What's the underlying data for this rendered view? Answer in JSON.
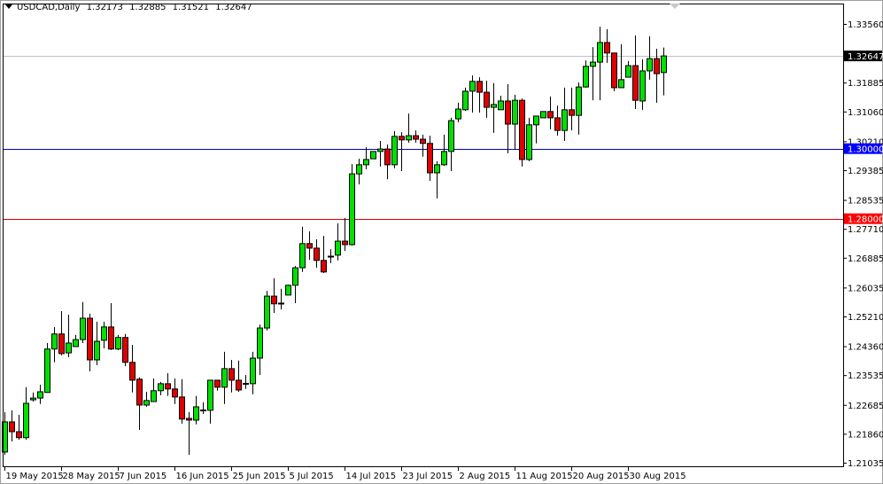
{
  "header": {
    "symbol": "USDCAD,Daily",
    "open": "1.32173",
    "high": "1.32885",
    "low": "1.31521",
    "close": "1.32647"
  },
  "colors": {
    "bull": "#00e000",
    "bear": "#e00000",
    "support_blue": "#0000c0",
    "support_red": "#e00000",
    "current": "#c0c0c0"
  },
  "chart_data": {
    "type": "candlestick",
    "title": "USDCAD,Daily",
    "ylim": [
      1.20933,
      1.34142
    ],
    "y_ticks": [
      "1.33560",
      "1.31885",
      "1.31060",
      "1.30210",
      "1.29385",
      "1.28535",
      "1.27710",
      "1.26885",
      "1.26035",
      "1.25210",
      "1.24360",
      "1.23535",
      "1.22685",
      "1.21860",
      "1.21035"
    ],
    "x_labels": [
      "19 May 2015",
      "28 May 2015",
      "7 Jun 2015",
      "16 Jun 2015",
      "25 Jun 2015",
      "5 Jul 2015",
      "14 Jul 2015",
      "23 Jul 2015",
      "2 Aug 2015",
      "11 Aug 2015",
      "20 Aug 2015",
      "30 Aug 2015"
    ],
    "x_label_every": 8,
    "horizontal_lines": [
      {
        "price": "1.30000",
        "value": 1.3,
        "color": "#0000c0",
        "label_bg": "#0000ff"
      },
      {
        "price": "1.28000",
        "value": 1.28,
        "color": "#e00000",
        "label_bg": "#ff0000"
      },
      {
        "price": "1.32647",
        "value": 1.32647,
        "color": "#c0c0c0",
        "label_bg": "#000000"
      }
    ],
    "ohlc": [
      [
        1.2134,
        1.2248,
        1.2126,
        1.222
      ],
      [
        1.222,
        1.2253,
        1.2164,
        1.2192
      ],
      [
        1.2192,
        1.224,
        1.2169,
        1.2175
      ],
      [
        1.2175,
        1.2319,
        1.2169,
        1.2273
      ],
      [
        1.2283,
        1.2304,
        1.2278,
        1.2288
      ],
      [
        1.2288,
        1.2326,
        1.2271,
        1.2306
      ],
      [
        1.2304,
        1.2445,
        1.2304,
        1.2428
      ],
      [
        1.2428,
        1.2491,
        1.239,
        1.2471
      ],
      [
        1.2471,
        1.2536,
        1.241,
        1.2415
      ],
      [
        1.2417,
        1.2526,
        1.2405,
        1.2445
      ],
      [
        1.2435,
        1.2468,
        1.2435,
        1.2455
      ],
      [
        1.2455,
        1.2562,
        1.2445,
        1.2516
      ],
      [
        1.2516,
        1.2529,
        1.2364,
        1.2397
      ],
      [
        1.2397,
        1.2506,
        1.2382,
        1.245
      ],
      [
        1.2453,
        1.2506,
        1.243,
        1.2491
      ],
      [
        1.2491,
        1.2559,
        1.2425,
        1.2428
      ],
      [
        1.2428,
        1.2468,
        1.2425,
        1.2461
      ],
      [
        1.2461,
        1.2471,
        1.2379,
        1.239
      ],
      [
        1.239,
        1.244,
        1.2304,
        1.2339
      ],
      [
        1.2342,
        1.2347,
        1.2197,
        1.2268
      ],
      [
        1.2268,
        1.2306,
        1.2263,
        1.2281
      ],
      [
        1.2278,
        1.2344,
        1.2278,
        1.2309
      ],
      [
        1.2309,
        1.2334,
        1.2296,
        1.2329
      ],
      [
        1.2329,
        1.2359,
        1.2294,
        1.2314
      ],
      [
        1.2314,
        1.2344,
        1.2271,
        1.2291
      ],
      [
        1.2291,
        1.2342,
        1.2215,
        1.2228
      ],
      [
        1.223,
        1.2248,
        1.2126,
        1.2225
      ],
      [
        1.2225,
        1.2294,
        1.2213,
        1.2263
      ],
      [
        1.2253,
        1.2276,
        1.2243,
        1.2254
      ],
      [
        1.2253,
        1.2339,
        1.2215,
        1.2339
      ],
      [
        1.2339,
        1.2339,
        1.2309,
        1.2319
      ],
      [
        1.2319,
        1.242,
        1.2271,
        1.2372
      ],
      [
        1.2372,
        1.2397,
        1.2304,
        1.2339
      ],
      [
        1.2339,
        1.2395,
        1.2306,
        1.2311
      ],
      [
        1.2329,
        1.2354,
        1.2314,
        1.233
      ],
      [
        1.2329,
        1.242,
        1.2299,
        1.2402
      ],
      [
        1.2402,
        1.2498,
        1.2354,
        1.2488
      ],
      [
        1.2488,
        1.2594,
        1.2481,
        1.2579
      ],
      [
        1.2579,
        1.263,
        1.2531,
        1.2557
      ],
      [
        1.2557,
        1.26,
        1.2541,
        1.2559
      ],
      [
        1.2582,
        1.2612,
        1.2582,
        1.261
      ],
      [
        1.261,
        1.2665,
        1.2559,
        1.266
      ],
      [
        1.266,
        1.2777,
        1.2648,
        1.2729
      ],
      [
        1.2729,
        1.2764,
        1.2683,
        1.2716
      ],
      [
        1.2716,
        1.2741,
        1.266,
        1.2681
      ],
      [
        1.2681,
        1.2751,
        1.2645,
        1.2648
      ],
      [
        1.2692,
        1.2713,
        1.2673,
        1.2693
      ],
      [
        1.2696,
        1.2787,
        1.2681,
        1.2736
      ],
      [
        1.2736,
        1.2802,
        1.2708,
        1.2726
      ],
      [
        1.2726,
        1.2956,
        1.2723,
        1.2928
      ],
      [
        1.2928,
        1.2971,
        1.2898,
        1.2954
      ],
      [
        1.2954,
        1.3004,
        1.2941,
        1.2969
      ],
      [
        1.2971,
        1.2992,
        1.2971,
        1.2992
      ],
      [
        1.2992,
        1.3022,
        1.2949,
        1.2999
      ],
      [
        1.2999,
        1.3012,
        1.2913,
        1.2954
      ],
      [
        1.2954,
        1.305,
        1.2944,
        1.3035
      ],
      [
        1.3035,
        1.3047,
        1.2936,
        1.3025
      ],
      [
        1.3025,
        1.31,
        1.3017,
        1.3037
      ],
      [
        1.3037,
        1.3052,
        1.3017,
        1.3027
      ],
      [
        1.3027,
        1.304,
        1.2977,
        1.3015
      ],
      [
        1.3015,
        1.3037,
        1.2908,
        1.2931
      ],
      [
        1.2931,
        1.2964,
        1.2858,
        1.2954
      ],
      [
        1.2954,
        1.304,
        1.2951,
        1.2992
      ],
      [
        1.2992,
        1.3088,
        1.2936,
        1.308
      ],
      [
        1.3085,
        1.3131,
        1.3075,
        1.3113
      ],
      [
        1.3111,
        1.3174,
        1.3108,
        1.3164
      ],
      [
        1.3164,
        1.3209,
        1.3103,
        1.3192
      ],
      [
        1.3192,
        1.3204,
        1.3103,
        1.3161
      ],
      [
        1.3161,
        1.3194,
        1.3088,
        1.3118
      ],
      [
        1.3118,
        1.3187,
        1.3045,
        1.3126
      ],
      [
        1.3111,
        1.3151,
        1.3111,
        1.3136
      ],
      [
        1.3136,
        1.3184,
        1.2987,
        1.307
      ],
      [
        1.307,
        1.3154,
        1.2997,
        1.3138
      ],
      [
        1.3138,
        1.3143,
        1.2949,
        1.2969
      ],
      [
        1.2969,
        1.3088,
        1.2964,
        1.3068
      ],
      [
        1.3068,
        1.3093,
        1.3015,
        1.3093
      ],
      [
        1.3088,
        1.3106,
        1.3088,
        1.3106
      ],
      [
        1.3106,
        1.3149,
        1.3055,
        1.3088
      ],
      [
        1.3088,
        1.3123,
        1.3037,
        1.3052
      ],
      [
        1.3052,
        1.3174,
        1.3022,
        1.3111
      ],
      [
        1.3111,
        1.3174,
        1.3052,
        1.3095
      ],
      [
        1.3095,
        1.3189,
        1.304,
        1.3176
      ],
      [
        1.3176,
        1.3252,
        1.3174,
        1.3235
      ],
      [
        1.3235,
        1.329,
        1.3138,
        1.3247
      ],
      [
        1.3247,
        1.3348,
        1.3138,
        1.3303
      ],
      [
        1.3303,
        1.3341,
        1.3245,
        1.3273
      ],
      [
        1.3273,
        1.3273,
        1.3164,
        1.3174
      ],
      [
        1.3174,
        1.3298,
        1.3174,
        1.3197
      ],
      [
        1.3204,
        1.325,
        1.3204,
        1.3237
      ],
      [
        1.3237,
        1.3323,
        1.3113,
        1.3138
      ],
      [
        1.3136,
        1.3255,
        1.3111,
        1.3222
      ],
      [
        1.3222,
        1.3321,
        1.3197,
        1.3257
      ],
      [
        1.3257,
        1.3285,
        1.3131,
        1.3214
      ],
      [
        1.32173,
        1.32885,
        1.31521,
        1.32647
      ]
    ]
  }
}
